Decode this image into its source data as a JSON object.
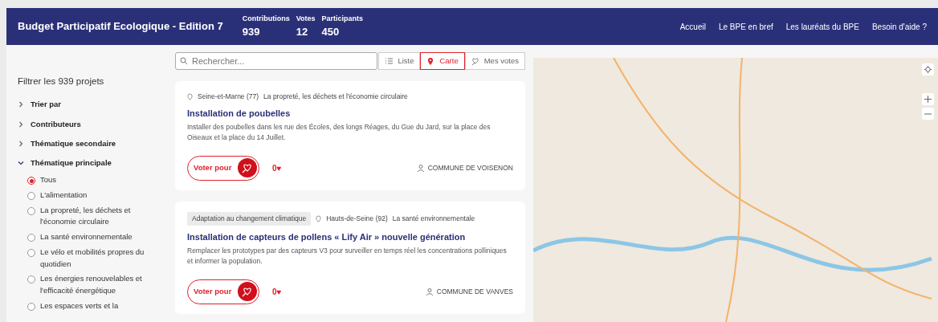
{
  "header": {
    "title": "Budget Participatif Ecologique - Edition 7",
    "stats": [
      {
        "label": "Contributions",
        "value": "939"
      },
      {
        "label": "Votes",
        "value": "12"
      },
      {
        "label": "Participants",
        "value": "450"
      }
    ],
    "nav": [
      "Accueil",
      "Le BPE en bref",
      "Les lauréats du BPE",
      "Besoin d'aide ?"
    ]
  },
  "filters": {
    "title": "Filtrer les 939 projets",
    "groups": [
      {
        "label": "Trier par",
        "expanded": false
      },
      {
        "label": "Contributeurs",
        "expanded": false
      },
      {
        "label": "Thématique secondaire",
        "expanded": false
      },
      {
        "label": "Thématique principale",
        "expanded": true,
        "options": [
          {
            "label": "Tous",
            "selected": true
          },
          {
            "label": "L'alimentation",
            "selected": false
          },
          {
            "label": "La propreté, les déchets et l'économie circulaire",
            "selected": false
          },
          {
            "label": "La santé environnementale",
            "selected": false
          },
          {
            "label": "Le vélo et mobilités propres du quotidien",
            "selected": false
          },
          {
            "label": "Les énergies renouvelables et l'efficacité énergétique",
            "selected": false
          },
          {
            "label": "Les espaces verts et la",
            "selected": false
          }
        ]
      }
    ]
  },
  "search": {
    "placeholder": "Rechercher..."
  },
  "views": [
    {
      "kind": "list",
      "label": "Liste",
      "selected": false
    },
    {
      "kind": "map",
      "label": "Carte",
      "selected": true
    },
    {
      "kind": "votes",
      "label": "Mes votes",
      "selected": false
    }
  ],
  "projects": [
    {
      "location": "Seine-et-Marne (77)",
      "theme": "La propreté, les déchets et l'économie circulaire",
      "title": "Installation de poubelles",
      "description": "Installer des poubelles dans les rue des Écoles, des longs Réages, du Gue du Jard, sur la place des Oiseaux et la place du 14 Juillet.",
      "vote_label": "Voter pour",
      "votes": "0♥",
      "author": "COMMUNE DE VOISENON"
    },
    {
      "tag": "Adaptation au changement climatique",
      "location": "Hauts-de-Seine (92)",
      "theme": "La santé environnementale",
      "title": "Installation de capteurs de pollens « Lify Air » nouvelle génération",
      "description": "Remplacer les prototypes par des capteurs V3 pour surveiller en temps réel les concentrations polliniques et informer la population.",
      "vote_label": "Voter pour",
      "votes": "0♥",
      "author": "COMMUNE DE VANVES"
    }
  ]
}
